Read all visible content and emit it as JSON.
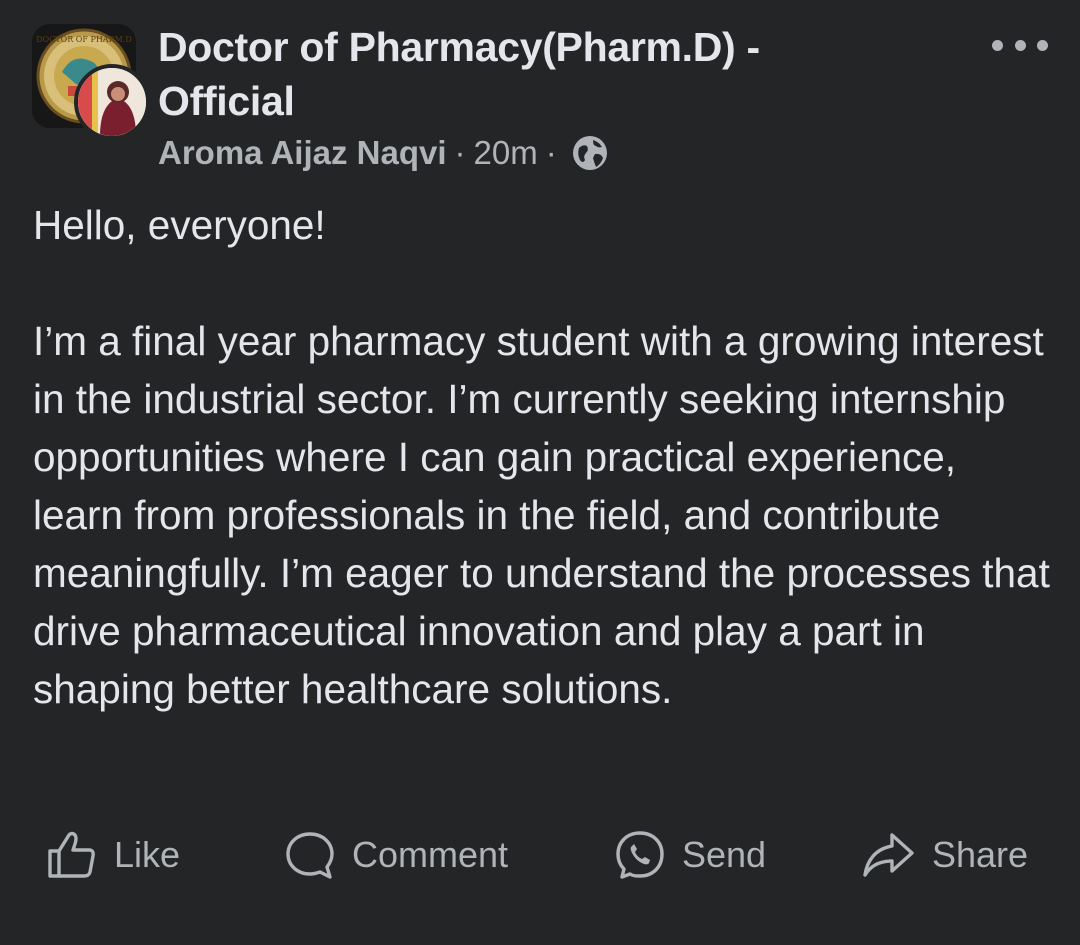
{
  "post": {
    "group_name": "Doctor of Pharmacy(Pharm.D) - Official",
    "author": "Aroma Aijaz Naqvi",
    "separator": "·",
    "time": "20m",
    "privacy_icon": "globe-icon",
    "more_icon": "more-options-icon",
    "group_avatar_text": "DOCTOR OF PHARM.D",
    "paragraphs": [
      "Hello, everyone!",
      "I’m a final year pharmacy student with a growing interest in the industrial sector. I’m currently seeking internship opportunities where I can gain practical experience, learn from professionals in the field, and contribute meaningfully. I’m eager to understand the processes that drive pharmaceutical innovation and play a part in shaping better healthcare solutions."
    ]
  },
  "actions": {
    "like": {
      "label": "Like",
      "icon": "thumbs-up-icon"
    },
    "comment": {
      "label": "Comment",
      "icon": "comment-bubble-icon"
    },
    "send": {
      "label": "Send",
      "icon": "messenger-icon"
    },
    "share": {
      "label": "Share",
      "icon": "share-arrow-icon"
    }
  },
  "colors": {
    "background": "#242526",
    "primary_text": "#e4e6eb",
    "secondary_text": "#b0b3b8"
  }
}
